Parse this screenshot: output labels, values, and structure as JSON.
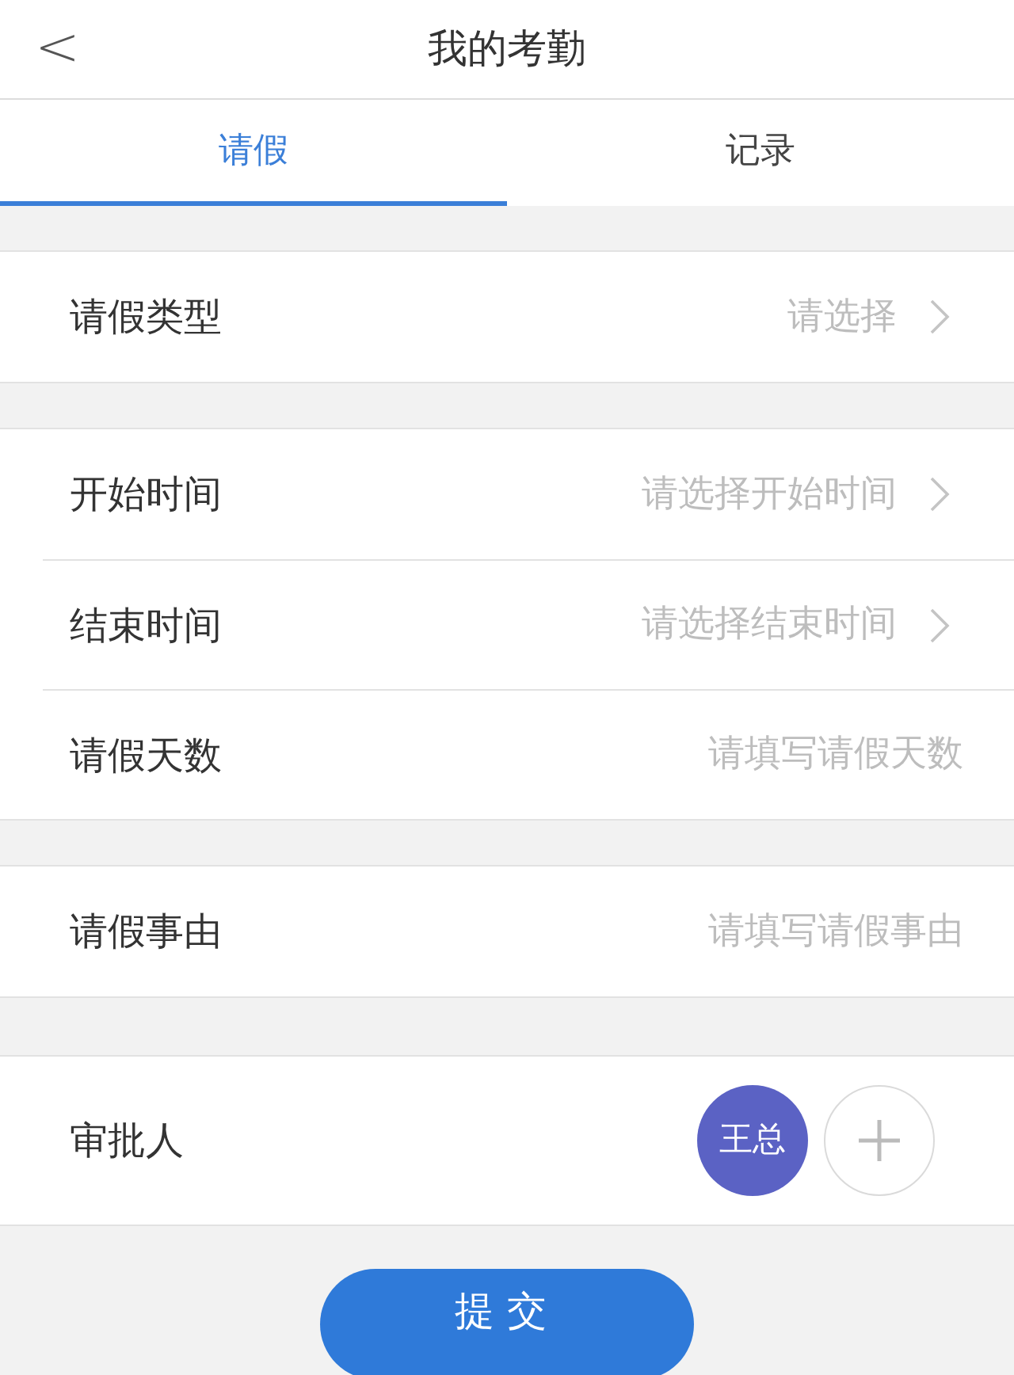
{
  "header": {
    "back": "<",
    "title": "我的考勤"
  },
  "tabs": [
    {
      "label": "请假",
      "selected": true
    },
    {
      "label": "记录",
      "selected": false
    }
  ],
  "groups": [
    {
      "rows": [
        {
          "kind": "select",
          "label": "请假类型",
          "placeholder": "请选择"
        }
      ]
    },
    {
      "rows": [
        {
          "kind": "select",
          "label": "开始时间",
          "placeholder": "请选择开始时间"
        },
        {
          "kind": "select",
          "label": "结束时间",
          "placeholder": "请选择结束时间"
        },
        {
          "kind": "input",
          "label": "请假天数",
          "placeholder": "请填写请假天数"
        }
      ]
    },
    {
      "rows": [
        {
          "kind": "input",
          "label": "请假事由",
          "placeholder": "请填写请假事由"
        }
      ]
    }
  ],
  "approver": {
    "label": "审批人",
    "people": [
      "王总"
    ]
  },
  "submit": "提交"
}
